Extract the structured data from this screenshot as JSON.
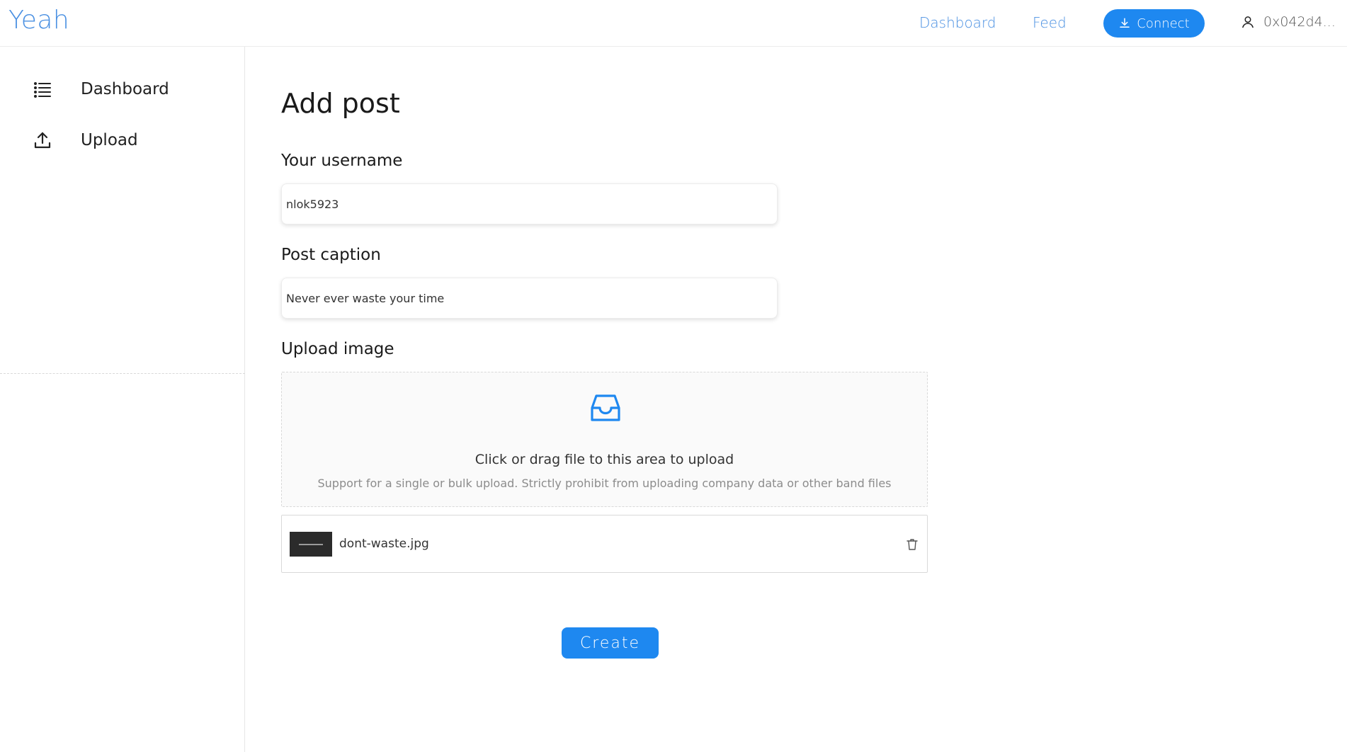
{
  "header": {
    "brand": "Yeah",
    "nav": {
      "dashboard": "Dashboard",
      "feed": "Feed"
    },
    "connect_label": "Connect",
    "account_address": "0x042d4..."
  },
  "sidebar": {
    "items": [
      {
        "label": "Dashboard",
        "icon": "list-icon"
      },
      {
        "label": "Upload",
        "icon": "upload-icon"
      }
    ]
  },
  "main": {
    "title": "Add post",
    "username": {
      "label": "Your username",
      "value": "nlok5923"
    },
    "caption": {
      "label": "Post caption",
      "value": "Never ever waste your time"
    },
    "upload": {
      "label": "Upload image",
      "dropzone_title": "Click or drag file to this area to upload",
      "dropzone_hint": "Support for a single or bulk upload. Strictly prohibit from uploading company data or other band files",
      "files": [
        {
          "name": "dont-waste.jpg"
        }
      ]
    },
    "create_label": "Create"
  },
  "colors": {
    "accent": "#1e88f0",
    "brand": "#4a90e2"
  }
}
